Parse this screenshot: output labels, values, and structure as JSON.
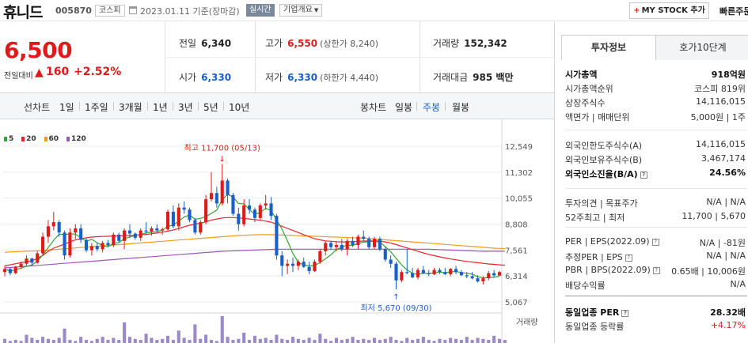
{
  "header": {
    "name": "휴니드",
    "code": "005870",
    "market": "코스피",
    "base_date": "2023.01.11  기준(장마감)",
    "realtime_label": "실시간",
    "overview_label": "기업개요",
    "mystock_label": "MY STOCK 추가",
    "quick_order_label": "빠른주문"
  },
  "summary": {
    "price": "6,500",
    "change_label": "전일대비",
    "change_value": "160",
    "change_rate": "+2.52%",
    "prev_close_label": "전일",
    "prev_close": "6,340",
    "high_label": "고가",
    "high": "6,550",
    "upper_limit": "(상한가 8,240)",
    "volume_label": "거래량",
    "volume": "152,342",
    "open_label": "시가",
    "open": "6,330",
    "low_label": "저가",
    "low": "6,330",
    "lower_limit": "(하한가 4,440)",
    "amount_label": "거래대금",
    "amount": "985 백만"
  },
  "period_tabs": {
    "line_title": "선차트",
    "line_items": [
      "1일",
      "1주일",
      "3개월",
      "1년",
      "3년",
      "5년",
      "10년"
    ],
    "candle_title": "봉차트",
    "candle_items": [
      "일봉",
      "주봉",
      "월봉"
    ],
    "candle_active": "주봉"
  },
  "side": {
    "tab_invest": "투자정보",
    "tab_orderbook": "호가10단계",
    "rows": [
      {
        "l": "시가총액",
        "r": "918억원",
        "bold": true
      },
      {
        "l": "시가총액순위",
        "r": "코스피 819위"
      },
      {
        "l": "상장주식수",
        "r": "14,116,015"
      },
      {
        "l": "액면가 | 매매단위",
        "r": "5,000원 | 1주"
      },
      {
        "l": "외국인한도주식수(A)",
        "r": "14,116,015"
      },
      {
        "l": "외국인보유주식수(B)",
        "r": "3,467,174"
      },
      {
        "l": "외국인소진율(B/A)",
        "r": "24.56%",
        "bold": true
      },
      {
        "l": "투자의견 | 목표주가",
        "r": "N/A | N/A"
      },
      {
        "l": "52주최고 | 최저",
        "r": "11,700 | 5,670"
      },
      {
        "l": "PER | EPS(2022.09)",
        "r": "N/A | -81원"
      },
      {
        "l": "추정PER | EPS",
        "r": "N/A | N/A"
      },
      {
        "l": "PBR | BPS(2022.09)",
        "r": "0.65배 | 10,006원"
      },
      {
        "l": "배당수익률",
        "r": "N/A"
      },
      {
        "l": "동일업종 PER",
        "r": "28.32배",
        "bold": true
      },
      {
        "l": "동일업종 등락률",
        "r": "+4.17%",
        "up": true
      }
    ]
  },
  "colors": {
    "up": "#e01a1a",
    "down": "#1a5fc8",
    "ma5": "#32a632",
    "ma20": "#e8242a",
    "ma60": "#f09a1e",
    "ma120": "#9b59b6",
    "volume": "#9a8ac8"
  },
  "chart_data": {
    "type": "candlestick",
    "legend": [
      "5",
      "20",
      "60",
      "120"
    ],
    "y_ticks": [
      "12,549",
      "11,302",
      "10,055",
      "8,808",
      "7,561",
      "6,314",
      "5,067"
    ],
    "y_tick_values": [
      12549,
      11302,
      10055,
      8808,
      7561,
      6314,
      5067
    ],
    "ylim": [
      5067,
      12549
    ],
    "volume_label": "거래량",
    "max_annotation": "최고 11,700 (05/13)",
    "min_annotation": "최저 5,670 (09/30)",
    "max_value": 11700,
    "min_value": 5670,
    "max_index": 40,
    "min_index": 72,
    "candles": [
      [
        6500,
        6800,
        6300,
        6650
      ],
      [
        6650,
        6700,
        6350,
        6450
      ],
      [
        6450,
        6800,
        6400,
        6750
      ],
      [
        6750,
        7000,
        6650,
        6900
      ],
      [
        6900,
        7300,
        6800,
        7150
      ],
      [
        7150,
        7200,
        6850,
        6950
      ],
      [
        6950,
        7500,
        6900,
        7400
      ],
      [
        7400,
        8400,
        7300,
        8200
      ],
      [
        8200,
        9000,
        7900,
        8700
      ],
      [
        8700,
        9400,
        8500,
        8900
      ],
      [
        8900,
        9000,
        8200,
        8400
      ],
      [
        8400,
        8500,
        7100,
        7300
      ],
      [
        7300,
        8600,
        7200,
        8400
      ],
      [
        8400,
        8800,
        8100,
        8600
      ],
      [
        8600,
        8800,
        7900,
        8050
      ],
      [
        8050,
        8150,
        7450,
        7550
      ],
      [
        7550,
        7900,
        7300,
        7750
      ],
      [
        7750,
        7900,
        7500,
        7600
      ],
      [
        7600,
        8000,
        7450,
        7900
      ],
      [
        7900,
        8050,
        7700,
        7800
      ],
      [
        7800,
        8400,
        7700,
        8300
      ],
      [
        8300,
        8400,
        7900,
        8000
      ],
      [
        8000,
        8600,
        7600,
        8500
      ],
      [
        8500,
        8800,
        8150,
        8350
      ],
      [
        8350,
        8400,
        8050,
        8150
      ],
      [
        8150,
        8600,
        8000,
        8500
      ],
      [
        8500,
        8900,
        8300,
        8450
      ],
      [
        8450,
        8700,
        8250,
        8600
      ],
      [
        8600,
        8800,
        8400,
        8500
      ],
      [
        8500,
        8650,
        8300,
        8550
      ],
      [
        8550,
        9500,
        8500,
        9400
      ],
      [
        9400,
        9700,
        8600,
        8700
      ],
      [
        8700,
        9800,
        8500,
        9600
      ],
      [
        9600,
        9900,
        9300,
        9500
      ],
      [
        9500,
        9600,
        8900,
        9000
      ],
      [
        9000,
        9100,
        8300,
        8400
      ],
      [
        8400,
        9000,
        8300,
        8900
      ],
      [
        8900,
        10200,
        8800,
        10000
      ],
      [
        10000,
        11300,
        9900,
        10300
      ],
      [
        10300,
        10600,
        9600,
        9800
      ],
      [
        9800,
        11700,
        9700,
        10900
      ],
      [
        10900,
        11000,
        9800,
        10200
      ],
      [
        10200,
        10300,
        9200,
        9300
      ],
      [
        9300,
        9600,
        8500,
        8800
      ],
      [
        8800,
        10000,
        8700,
        9700
      ],
      [
        9700,
        10000,
        9300,
        9500
      ],
      [
        9500,
        9600,
        8900,
        9100
      ],
      [
        9100,
        9800,
        9000,
        9700
      ],
      [
        9700,
        10200,
        9500,
        9800
      ],
      [
        9800,
        10100,
        9000,
        9200
      ],
      [
        9200,
        9300,
        7100,
        7300
      ],
      [
        7300,
        7500,
        6300,
        6800
      ],
      [
        6800,
        7100,
        6400,
        6900
      ],
      [
        6900,
        7200,
        6500,
        6800
      ],
      [
        6800,
        7100,
        6600,
        7000
      ],
      [
        7000,
        7200,
        6700,
        6750
      ],
      [
        6750,
        7000,
        6400,
        6550
      ],
      [
        6550,
        7100,
        6500,
        7000
      ],
      [
        7000,
        7600,
        6900,
        7500
      ],
      [
        7500,
        8000,
        7300,
        7900
      ],
      [
        7900,
        8000,
        7600,
        7700
      ],
      [
        7700,
        8000,
        7500,
        7800
      ],
      [
        7800,
        8100,
        7500,
        7600
      ],
      [
        7600,
        8100,
        7300,
        8000
      ],
      [
        8000,
        8200,
        7700,
        7800
      ],
      [
        7800,
        8300,
        7600,
        8200
      ],
      [
        8200,
        8500,
        8000,
        8100
      ],
      [
        8100,
        8200,
        7600,
        7700
      ],
      [
        7700,
        8200,
        7600,
        8100
      ],
      [
        8100,
        8200,
        7500,
        7600
      ],
      [
        7600,
        7700,
        7000,
        7100
      ],
      [
        7100,
        7300,
        6700,
        6900
      ],
      [
        6900,
        7000,
        5670,
        6100
      ],
      [
        6100,
        6600,
        6000,
        6500
      ],
      [
        6500,
        7600,
        6400,
        6450
      ],
      [
        6450,
        6700,
        6200,
        6250
      ],
      [
        6250,
        6700,
        6150,
        6600
      ],
      [
        6600,
        6800,
        6400,
        6450
      ],
      [
        6450,
        6600,
        6300,
        6400
      ],
      [
        6400,
        6700,
        6350,
        6600
      ],
      [
        6600,
        6700,
        6400,
        6500
      ],
      [
        6500,
        6700,
        6350,
        6400
      ],
      [
        6400,
        6700,
        6300,
        6650
      ],
      [
        6650,
        6800,
        6400,
        6500
      ],
      [
        6500,
        6600,
        6300,
        6350
      ],
      [
        6350,
        6500,
        6200,
        6300
      ],
      [
        6300,
        6500,
        6150,
        6200
      ],
      [
        6200,
        6350,
        6000,
        6050
      ],
      [
        6050,
        6300,
        5900,
        6200
      ],
      [
        6200,
        6550,
        6100,
        6450
      ],
      [
        6450,
        6600,
        6250,
        6340
      ],
      [
        6330,
        6550,
        6330,
        6500
      ]
    ],
    "ma20": [
      6800,
      6850,
      6900,
      6950,
      7000,
      7050,
      7150,
      7300,
      7500,
      7650,
      7750,
      7850,
      7950,
      8050,
      8100,
      8150,
      8180,
      8200,
      8210,
      8220,
      8230,
      8240,
      8250,
      8260,
      8270,
      8290,
      8310,
      8340,
      8380,
      8420,
      8470,
      8520,
      8600,
      8680,
      8750,
      8800,
      8850,
      8920,
      9000,
      9050,
      9100,
      9120,
      9120,
      9100,
      9080,
      9050,
      9020,
      8990,
      8950,
      8900,
      8800,
      8700,
      8600,
      8500,
      8400,
      8300,
      8200,
      8100,
      8050,
      8000,
      7980,
      7960,
      7950,
      7950,
      7960,
      7980,
      7990,
      8000,
      8000,
      7990,
      7950,
      7900,
      7820,
      7740,
      7660,
      7580,
      7500,
      7420,
      7350,
      7290,
      7230,
      7180,
      7130,
      7090,
      7050,
      7010,
      6980,
      6950,
      6920,
      6890,
      6870,
      6850,
      6830
    ],
    "ma60": [
      7450,
      7470,
      7480,
      7490,
      7500,
      7510,
      7520,
      7540,
      7560,
      7580,
      7600,
      7620,
      7640,
      7660,
      7680,
      7700,
      7720,
      7740,
      7760,
      7780,
      7800,
      7820,
      7840,
      7860,
      7880,
      7900,
      7920,
      7940,
      7960,
      7980,
      8000,
      8020,
      8040,
      8060,
      8080,
      8100,
      8120,
      8140,
      8160,
      8180,
      8200,
      8220,
      8240,
      8260,
      8270,
      8280,
      8290,
      8300,
      8300,
      8300,
      8290,
      8280,
      8270,
      8260,
      8250,
      8240,
      8230,
      8220,
      8210,
      8200,
      8190,
      8180,
      8170,
      8160,
      8150,
      8140,
      8130,
      8110,
      8090,
      8070,
      8050,
      8030,
      8010,
      7990,
      7970,
      7950,
      7930,
      7910,
      7890,
      7870,
      7850,
      7830,
      7810,
      7790,
      7770,
      7750,
      7730,
      7710,
      7690,
      7670,
      7650,
      7640,
      7630
    ],
    "ma120": [
      6700,
      6720,
      6740,
      6760,
      6780,
      6800,
      6820,
      6840,
      6860,
      6880,
      6900,
      6920,
      6940,
      6960,
      6980,
      7000,
      7020,
      7040,
      7060,
      7080,
      7100,
      7120,
      7140,
      7160,
      7180,
      7200,
      7220,
      7240,
      7260,
      7280,
      7300,
      7320,
      7340,
      7360,
      7380,
      7400,
      7420,
      7440,
      7460,
      7480,
      7500,
      7510,
      7520,
      7530,
      7540,
      7550,
      7560,
      7570,
      7580,
      7590,
      7600,
      7600,
      7600,
      7600,
      7600,
      7600,
      7600,
      7600,
      7600,
      7600,
      7600,
      7600,
      7600,
      7600,
      7600,
      7600,
      7600,
      7600,
      7600,
      7600,
      7600,
      7600,
      7600,
      7600,
      7600,
      7600,
      7600,
      7600,
      7600,
      7590,
      7580,
      7570,
      7560,
      7550,
      7540,
      7530,
      7520,
      7510,
      7500,
      7500,
      7500,
      7500,
      7500
    ],
    "volumes": [
      4,
      2,
      3,
      2,
      8,
      5,
      3,
      6,
      4,
      3,
      5,
      14,
      3,
      2,
      6,
      3,
      2,
      4,
      6,
      3,
      5,
      3,
      20,
      6,
      4,
      3,
      9,
      5,
      3,
      4,
      7,
      3,
      12,
      5,
      3,
      18,
      4,
      8,
      3,
      2,
      26,
      6,
      3,
      4,
      10,
      3,
      7,
      4,
      5,
      3,
      8,
      4,
      3,
      6,
      4,
      3,
      5,
      3,
      9,
      4,
      2,
      5,
      3,
      4,
      6,
      3,
      4,
      3,
      5,
      3,
      4,
      6,
      3,
      2,
      5,
      3,
      4,
      6,
      3,
      2,
      4,
      3,
      5,
      4,
      3,
      6,
      3,
      5,
      4,
      3,
      7,
      4,
      3
    ]
  }
}
